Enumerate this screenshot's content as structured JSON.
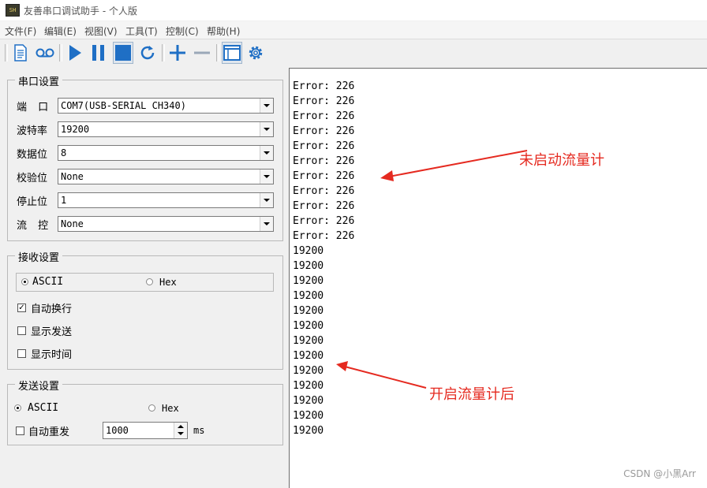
{
  "window": {
    "title": "友善串口调试助手 - 个人版",
    "icon_text": "SH"
  },
  "menu": [
    "文件(F)",
    "编辑(E)",
    "视图(V)",
    "工具(T)",
    "控制(C)",
    "帮助(H)"
  ],
  "toolbar": {
    "icons": [
      "new-file-icon",
      "record-icon",
      "play-icon",
      "pause-icon",
      "stop-icon",
      "refresh-icon",
      "plus-icon",
      "minus-icon",
      "window-icon",
      "settings-icon"
    ],
    "accent": "#1f6fc5"
  },
  "serial": {
    "legend": "串口设置",
    "rows": [
      {
        "label": "端  口",
        "value": "COM7(USB-SERIAL CH340)"
      },
      {
        "label": "波特率",
        "value": "19200"
      },
      {
        "label": "数据位",
        "value": "8"
      },
      {
        "label": "校验位",
        "value": "None"
      },
      {
        "label": "停止位",
        "value": "1"
      },
      {
        "label": "流  控",
        "value": "None"
      }
    ]
  },
  "receive": {
    "legend": "接收设置",
    "ascii_label": "ASCII",
    "hex_label": "Hex",
    "selected": "ASCII",
    "options": [
      {
        "label": "自动换行",
        "checked": true
      },
      {
        "label": "显示发送",
        "checked": false
      },
      {
        "label": "显示时间",
        "checked": false
      }
    ]
  },
  "send": {
    "legend": "发送设置",
    "ascii_label": "ASCII",
    "hex_label": "Hex",
    "selected": "ASCII",
    "auto_resend_label": "自动重发",
    "auto_resend_checked": false,
    "interval_value": "1000",
    "interval_unit": "ms"
  },
  "output": {
    "lines": [
      "Error: 226",
      "Error: 226",
      "Error: 226",
      "Error: 226",
      "Error: 226",
      "Error: 226",
      "Error: 226",
      "Error: 226",
      "Error: 226",
      "Error: 226",
      "Error: 226",
      "19200",
      "19200",
      "19200",
      "19200",
      "19200",
      "19200",
      "19200",
      "19200",
      "19200",
      "19200",
      "19200",
      "19200",
      "19200"
    ]
  },
  "annotations": {
    "before": "未启动流量计",
    "after": "开启流量计后",
    "color": "#e52a20"
  },
  "watermark": "CSDN @小黑Arr"
}
